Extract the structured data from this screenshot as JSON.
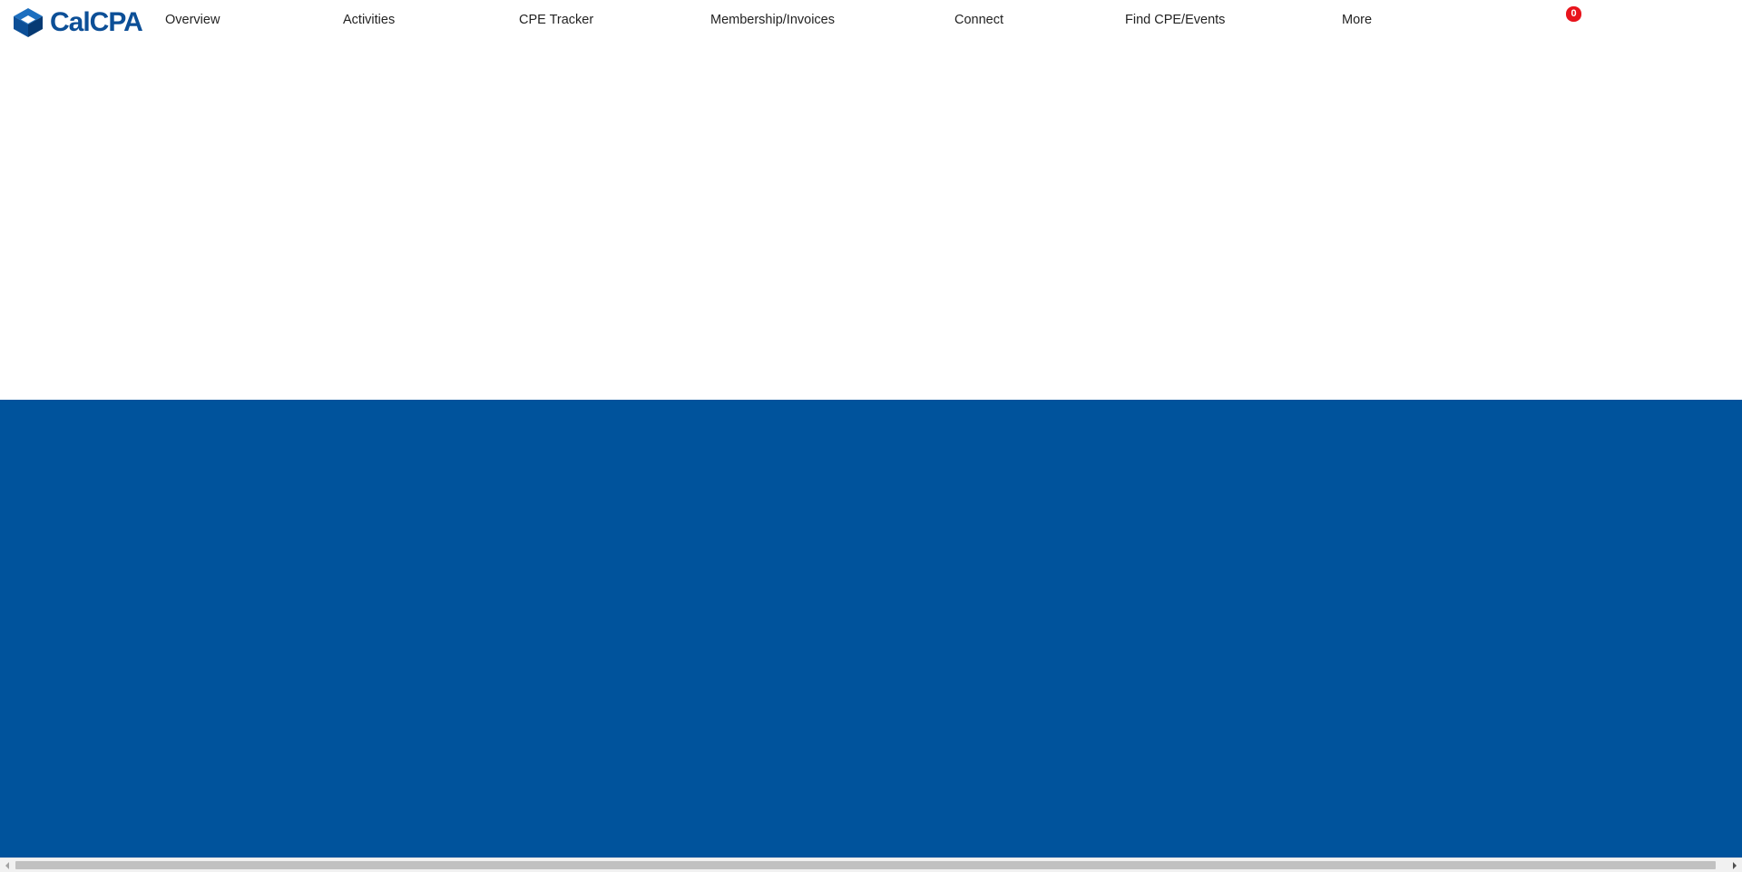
{
  "brand": {
    "name": "CalCPA",
    "logo_icon": "calcpa-cube-logo-icon",
    "color": "#0c4f97"
  },
  "nav": {
    "items": [
      {
        "label": "Overview"
      },
      {
        "label": "Activities"
      },
      {
        "label": "CPE Tracker"
      },
      {
        "label": "Membership/Invoices"
      },
      {
        "label": "Connect"
      },
      {
        "label": "Find CPE/Events"
      },
      {
        "label": "More"
      }
    ]
  },
  "cart": {
    "icon": "cart-icon",
    "count": "0",
    "badge_color": "#e8141c"
  },
  "hero": {
    "background_color": "#00539c"
  },
  "scrollbar": {
    "orientation": "horizontal",
    "left_arrow_icon": "scroll-left-arrow-icon",
    "right_arrow_icon": "scroll-right-arrow-icon"
  }
}
